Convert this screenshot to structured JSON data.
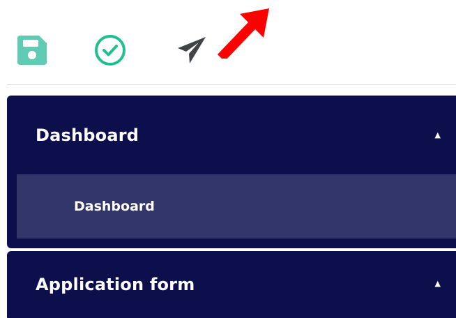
{
  "toolbar": {
    "icons": [
      "save-icon",
      "check-circle-icon",
      "send-icon"
    ],
    "colors": {
      "save": "#5fcbb3",
      "check": "#1fbf8f",
      "send": "#3f4447",
      "annotation": "#ff0000"
    }
  },
  "menu": {
    "sections": [
      {
        "title": "Dashboard",
        "items": [
          {
            "label": "Dashboard"
          }
        ]
      },
      {
        "title": "Application form",
        "items": []
      }
    ],
    "colors": {
      "section_bg": "#0d0f4d",
      "item_bg": "#33366a",
      "text": "#ffffff"
    }
  }
}
